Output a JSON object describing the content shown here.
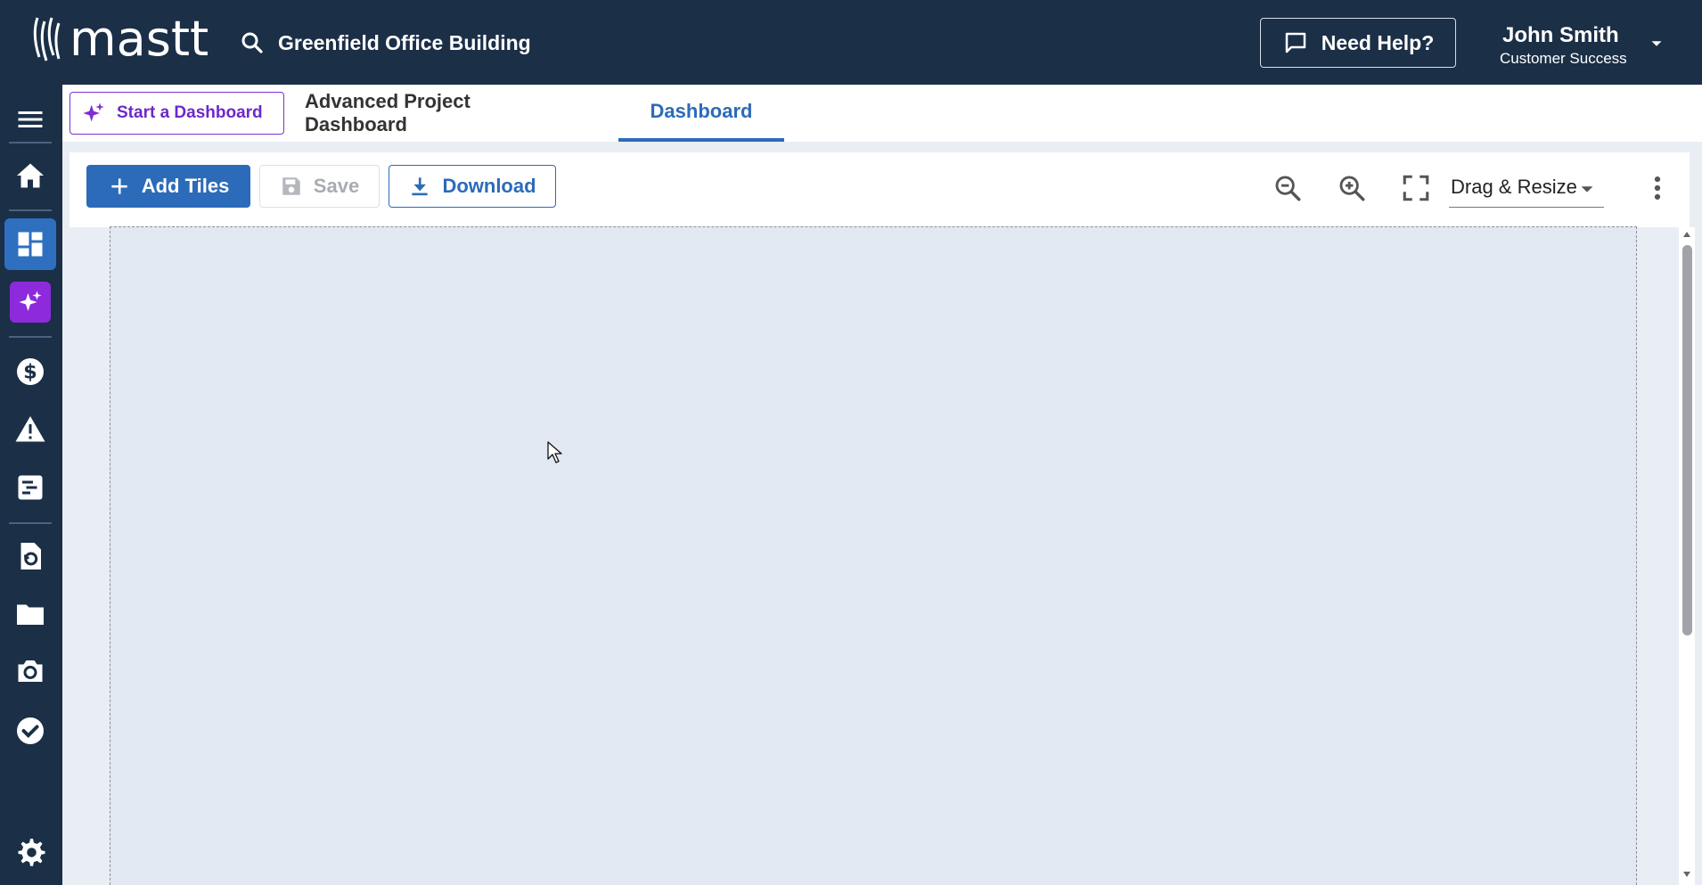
{
  "app": {
    "logo_text": "mastt",
    "project_name": "Greenfield Office Building",
    "help_label": "Need Help?",
    "user": {
      "name": "John Smith",
      "role": "Customer Success"
    }
  },
  "sidebar": {
    "items": [
      {
        "name": "menu-icon"
      },
      {
        "name": "home-icon"
      },
      {
        "name": "dashboard-icon",
        "active": true
      },
      {
        "name": "ai-sparkle-icon"
      },
      {
        "name": "dollar-icon"
      },
      {
        "name": "warning-icon"
      },
      {
        "name": "gantt-icon"
      },
      {
        "name": "document-history-icon"
      },
      {
        "name": "folder-icon"
      },
      {
        "name": "camera-icon"
      },
      {
        "name": "check-circle-icon"
      },
      {
        "name": "gear-icon"
      }
    ]
  },
  "tabs": {
    "start_label": "Start a Dashboard",
    "items": [
      {
        "label": "Advanced Project Dashboard",
        "active": false
      },
      {
        "label": "Dashboard",
        "active": true
      }
    ]
  },
  "toolbar": {
    "add_tiles_label": "Add Tiles",
    "save_label": "Save",
    "download_label": "Download",
    "mode_value": "Drag & Resize"
  },
  "colors": {
    "nav_bg": "#1b2f47",
    "primary": "#2c6bb9",
    "ai_purple": "#8d2bdc",
    "canvas_bg": "#e1e8f1"
  }
}
